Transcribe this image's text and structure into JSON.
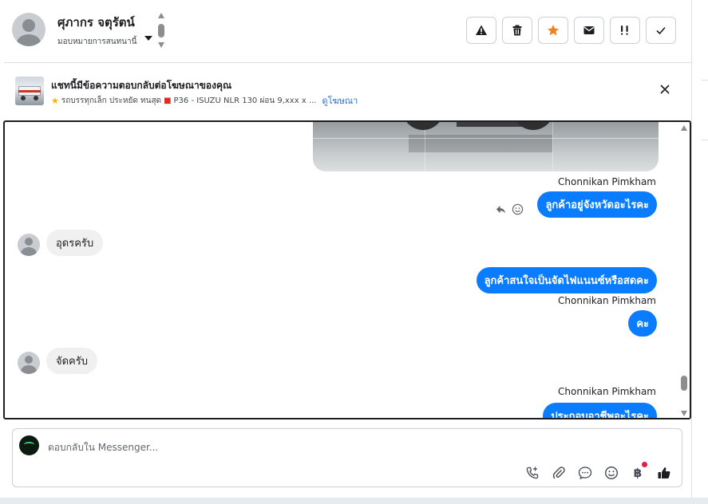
{
  "header": {
    "contact_name": "ศุภากร จตุรัตน์",
    "assign_label": "มอบหมายการสนทนานี้",
    "toolbar": [
      {
        "name": "report-spam-button",
        "icon": "warning-icon"
      },
      {
        "name": "delete-button",
        "icon": "trash-icon"
      },
      {
        "name": "star-button",
        "icon": "star-icon",
        "color": "#f5821f"
      },
      {
        "name": "mark-unread-button",
        "icon": "envelope-icon"
      },
      {
        "name": "follow-up-button",
        "icon": "priority-icon"
      },
      {
        "name": "mark-done-button",
        "icon": "check-icon"
      }
    ]
  },
  "ad": {
    "title": "แชทนี้มีข้อความตอบกลับต่อโฆษณาของคุณ",
    "summary": "รถบรรทุกเล็ก ประหยัด ทนสุด",
    "detail": "P36 - ISUZU NLR 130 ผ่อน 9,xxx x ...",
    "link": "ดูโฆษณา"
  },
  "messages": [
    {
      "sender": "Chonnikan Pimkham",
      "text": "ลูกค้าอยู่จังหวัดอะไรคะ",
      "direction": "outgoing"
    },
    {
      "text": "อุดรครับ",
      "direction": "incoming"
    },
    {
      "text": "ลูกค้าสนใจเป็นจัดไฟแนนซ์หรือสดคะ",
      "direction": "outgoing"
    },
    {
      "sender": "Chonnikan Pimkham",
      "text": "คะ",
      "direction": "outgoing"
    },
    {
      "text": "จัดครับ",
      "direction": "incoming"
    },
    {
      "sender": "Chonnikan Pimkham",
      "text": "ประกอบอาชีพอะไรคะ",
      "direction": "outgoing"
    }
  ],
  "composer": {
    "placeholder": "ตอบกลับใน Messenger...",
    "icons": [
      "call-add-icon",
      "attachment-icon",
      "saved-reply-icon",
      "emoji-icon",
      "baht-payment-icon",
      "like-icon"
    ]
  },
  "colors": {
    "accent": "#0a7cff",
    "incoming_bubble": "#f0f0f0",
    "link": "#216fdb",
    "star": "#f5821f"
  }
}
